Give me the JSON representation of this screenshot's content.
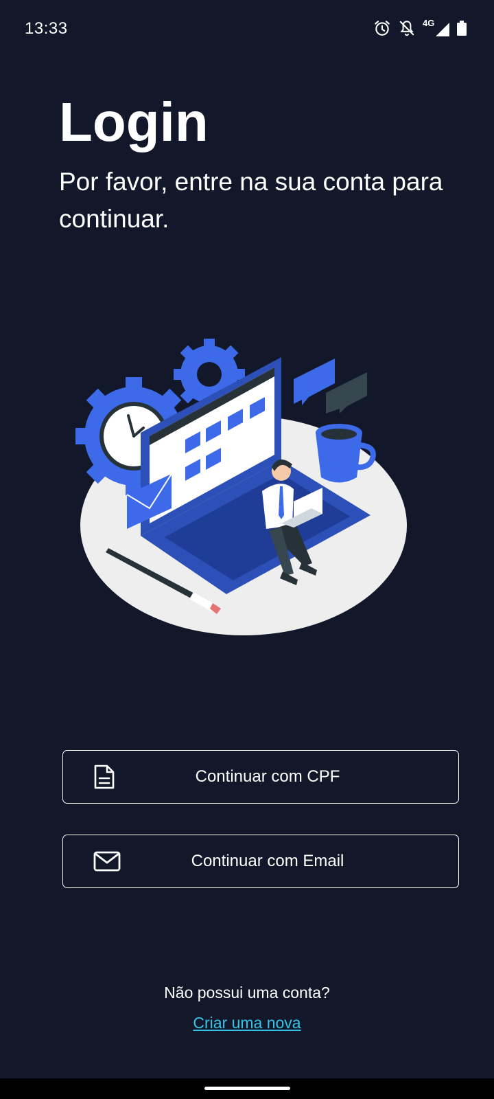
{
  "status_bar": {
    "time": "13:33",
    "network": "4G",
    "icons": [
      "alarm-icon",
      "notifications-off-icon",
      "signal-icon",
      "battery-icon"
    ]
  },
  "header": {
    "title": "Login",
    "subtitle": "Por favor, entre na sua conta para continuar."
  },
  "illustration": {
    "icon": "laptop-workspace-illustration"
  },
  "buttons": {
    "cpf": {
      "label": "Continuar com CPF",
      "icon": "document-icon"
    },
    "email": {
      "label": "Continuar com Email",
      "icon": "mail-icon"
    }
  },
  "footer": {
    "prompt": "Não possui uma conta?",
    "link": "Criar uma nova"
  },
  "colors": {
    "background": "#121829",
    "accent_link": "#35c4e8",
    "illustration_blue": "#3d6ae8"
  }
}
